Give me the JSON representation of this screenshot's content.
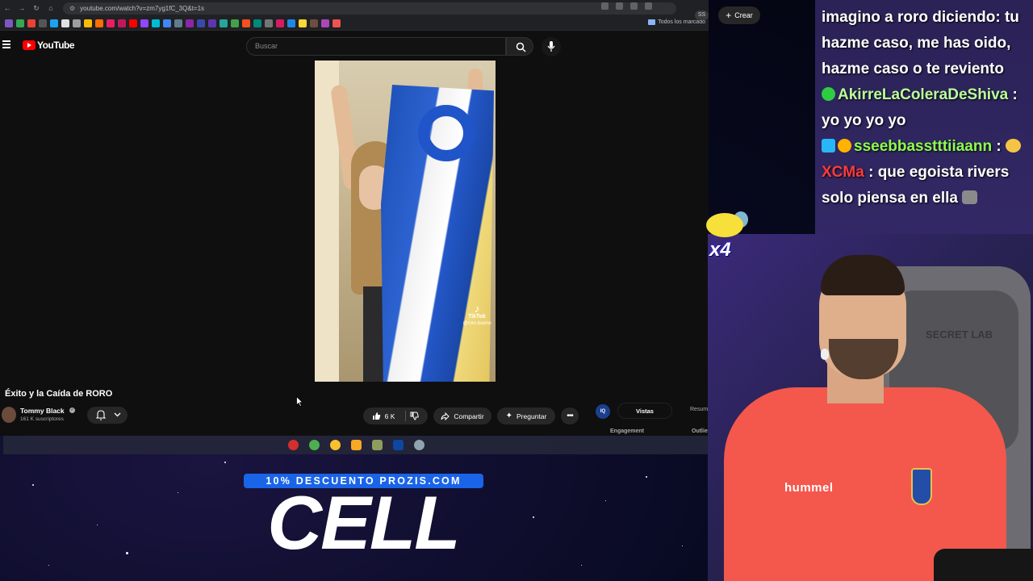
{
  "browser": {
    "url": "youtube.com/watch?v=zm7yg1fC_3Q&t=1s",
    "bookmarks_folder": "Todos los marcado"
  },
  "youtube": {
    "logo_text": "YouTube",
    "search_placeholder": "Buscar",
    "badge_ss": "SS",
    "create_label": "Crear"
  },
  "video": {
    "watermark_brand": "TikTok",
    "watermark_handle": "@roro.bueno",
    "title": "Éxito y la Caída de RORO",
    "channel_name": "Tommy Black",
    "subscribers": "161 K suscriptores",
    "likes": "6 K",
    "share_label": "Compartir",
    "ask_label": "Preguntar"
  },
  "extension_panel": {
    "badge": "IQ",
    "tab_active": "Vistas",
    "tab_other": "Resum",
    "label_engagement": "Engagement",
    "label_outlier": "Outlie"
  },
  "sponsor": {
    "discount_text": "10% DESCUENTO PROZIS.COM",
    "code_word": "CELL"
  },
  "chat": {
    "messages": [
      {
        "user": "",
        "text": "imagino a roro diciendo: tu hazme caso, me has oido, hazme caso o te reviento"
      },
      {
        "user": "AkirreLaColeraDeShiva",
        "sep": ":",
        "text": "yo yo yo yo"
      },
      {
        "user": "sseebbasstttiiaann",
        "sep": ":",
        "text": ""
      },
      {
        "user": "XCMa",
        "sep": ":",
        "text": "que egoista rivers solo piensa en ella"
      }
    ]
  },
  "overlay": {
    "combo": "x4",
    "chair_brand": "SECRET LAB",
    "shirt_brand": "hummel"
  },
  "colors": {
    "youtube_red": "#ff0000",
    "sponsor_blue": "#1a64e8",
    "chat_bg": "#2e245c",
    "shirt": "#f4574b"
  }
}
